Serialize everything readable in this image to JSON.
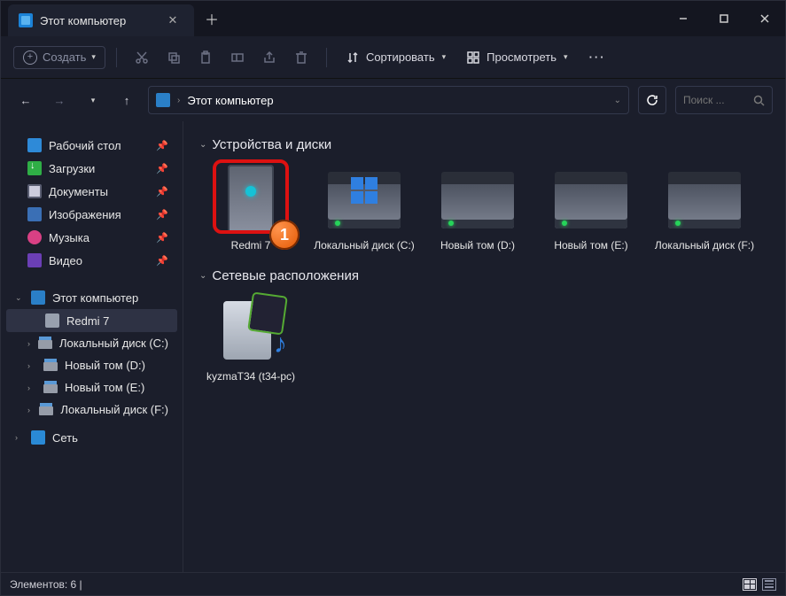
{
  "tab": {
    "title": "Этот компьютер"
  },
  "toolbar": {
    "create": "Создать",
    "sort": "Сортировать",
    "view": "Просмотреть"
  },
  "breadcrumb": {
    "root": "Этот компьютер"
  },
  "search": {
    "placeholder": "Поиск ..."
  },
  "sidebar": {
    "quick": [
      {
        "label": "Рабочий стол"
      },
      {
        "label": "Загрузки"
      },
      {
        "label": "Документы"
      },
      {
        "label": "Изображения"
      },
      {
        "label": "Музыка"
      },
      {
        "label": "Видео"
      }
    ],
    "pc": "Этот компьютер",
    "pc_children": [
      {
        "label": "Redmi 7"
      },
      {
        "label": "Локальный диск (C:)"
      },
      {
        "label": "Новый том (D:)"
      },
      {
        "label": "Новый том (E:)"
      },
      {
        "label": "Локальный диск (F:)"
      }
    ],
    "network": "Сеть"
  },
  "groups": {
    "devices": "Устройства и диски",
    "network": "Сетевые расположения"
  },
  "devices": [
    {
      "label": "Redmi 7"
    },
    {
      "label": "Локальный диск (C:)"
    },
    {
      "label": "Новый том (D:)"
    },
    {
      "label": "Новый том (E:)"
    },
    {
      "label": "Локальный диск (F:)"
    }
  ],
  "netloc": [
    {
      "label": "kyzmaT34 (t34-pc)"
    }
  ],
  "annotation": {
    "badge": "1"
  },
  "status": {
    "elements_label": "Элементов: 6"
  }
}
